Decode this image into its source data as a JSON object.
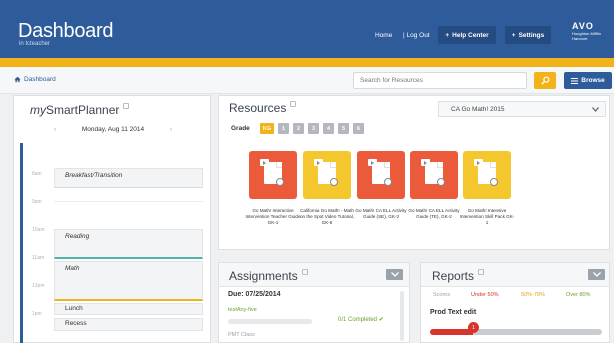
{
  "header": {
    "title": "Dashboard",
    "subtitle": "in tcteacher",
    "home": "Home",
    "logout": "| Log Out",
    "help": "Help Center",
    "settings": "Settings",
    "brand_mark": "AVO",
    "brand_text": "Houghton Mifflin Harcourt",
    "bg_color": "#2e5b9a",
    "accent_color": "#f2b318"
  },
  "toolbar": {
    "breadcrumb": "Dashboard",
    "search_placeholder": "Search for Resources",
    "browse": "Browse"
  },
  "planner": {
    "title_prefix": "my",
    "title_main": "SmartPlanner",
    "date": "Monday, Aug 11 2014",
    "times": [
      "8am",
      "9am",
      "10am",
      "11am",
      "12pm",
      "1pm"
    ],
    "events": [
      "Breakfast/Transition",
      "Reading",
      "Math",
      "Lunch",
      "Recess"
    ]
  },
  "resources": {
    "title": "Resources",
    "program": "CA Go Math! 2015",
    "grade_label": "Grade",
    "grades": [
      "KG",
      "1",
      "2",
      "3",
      "4",
      "5",
      "6"
    ],
    "active_grade": "KG",
    "tiles": [
      {
        "caption": "Go Math! Interactive Intervention Teacher Guide GK-1",
        "color": "#ec5a3c"
      },
      {
        "caption": "California Go Math! - Math on the Spot Video Tutorial, GK-6",
        "color": "#f4c72e"
      },
      {
        "caption": "Go Math! CA ELL Activity Guide (SE), GK-2",
        "color": "#ec5a3c"
      },
      {
        "caption": "Go Math! CA ELL Activity Guide (TE), GK-2",
        "color": "#ec5a3c"
      },
      {
        "caption": "Go Math! Intensive Intervention Skill Pack GK-1",
        "color": "#f4c72e"
      }
    ]
  },
  "assignments": {
    "title": "Assignments",
    "due": "Due: 07/25/2014",
    "item_name": "testAny-five",
    "status": "0/1 Completed",
    "status_icon": "check-icon",
    "class": "PMT Class"
  },
  "reports": {
    "title": "Reports",
    "scores_label": "Scores",
    "under": "Under 50%",
    "mid": "50%-79%",
    "over": "Over 80%",
    "item": "Prod Text edit",
    "marker": "1",
    "progress_fraction": 0.25
  }
}
